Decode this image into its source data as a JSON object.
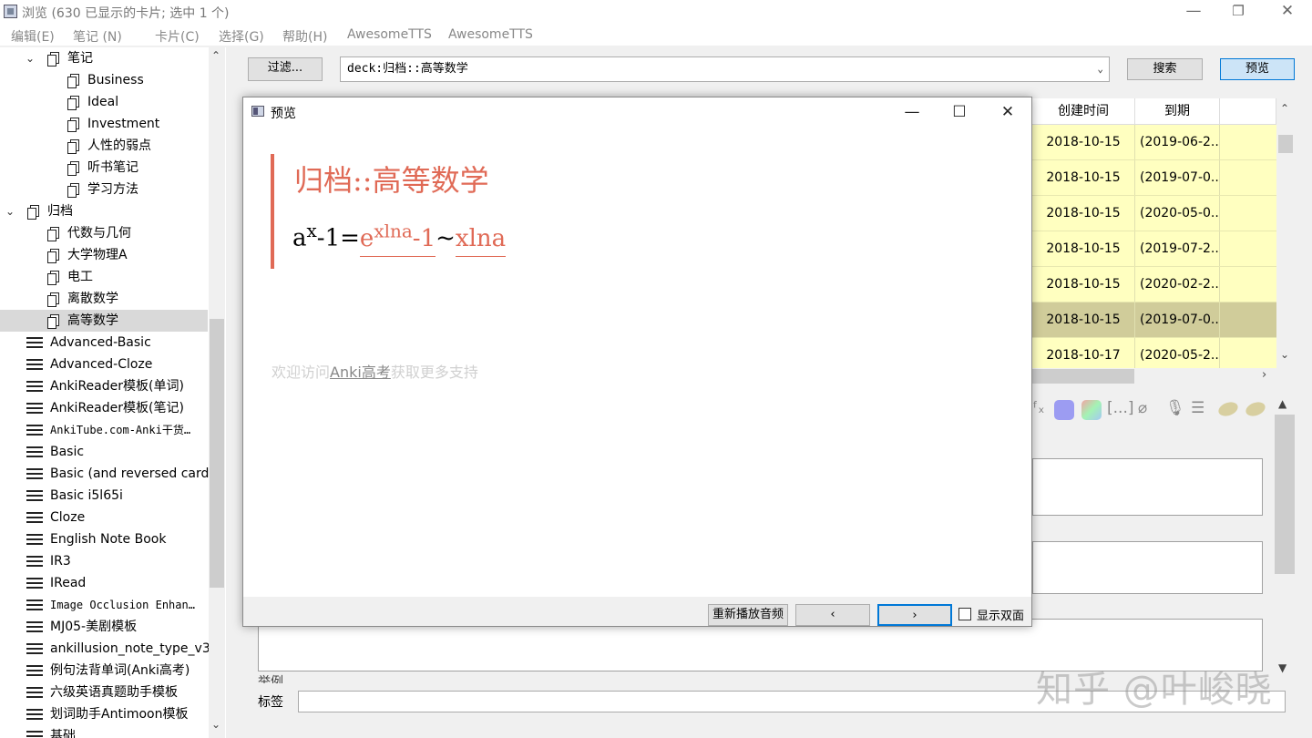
{
  "window": {
    "title": "浏览 (630 已显示的卡片; 选中 1 个)"
  },
  "window_controls": {
    "minimize": "—",
    "restore": "❐",
    "close": "✕"
  },
  "menu": [
    "编辑(E)",
    "笔记 (N)",
    "卡片(C)",
    "选择(G)",
    "帮助(H)",
    "AwesomeTTS",
    "AwesomeTTS"
  ],
  "sidebar": {
    "items": [
      {
        "label": "笔记",
        "level": 1,
        "kind": "deck",
        "arrow": "⌄"
      },
      {
        "label": "Business",
        "level": 2,
        "kind": "deck"
      },
      {
        "label": "Ideal",
        "level": 2,
        "kind": "deck"
      },
      {
        "label": "Investment",
        "level": 2,
        "kind": "deck"
      },
      {
        "label": "人性的弱点",
        "level": 2,
        "kind": "deck"
      },
      {
        "label": "听书笔记",
        "level": 2,
        "kind": "deck"
      },
      {
        "label": "学习方法",
        "level": 2,
        "kind": "deck"
      },
      {
        "label": "归档",
        "level": 0,
        "kind": "deck",
        "arrow": "⌄"
      },
      {
        "label": "代数与几何",
        "level": 1,
        "kind": "deck"
      },
      {
        "label": "大学物理A",
        "level": 1,
        "kind": "deck"
      },
      {
        "label": "电工",
        "level": 1,
        "kind": "deck"
      },
      {
        "label": "离散数学",
        "level": 1,
        "kind": "deck"
      },
      {
        "label": "高等数学",
        "level": 1,
        "kind": "deck",
        "selected": true
      },
      {
        "label": "Advanced-Basic",
        "level": 0,
        "kind": "note"
      },
      {
        "label": "Advanced-Cloze",
        "level": 0,
        "kind": "note"
      },
      {
        "label": "AnkiReader模板(单词)",
        "level": 0,
        "kind": "note"
      },
      {
        "label": "AnkiReader模板(笔记)",
        "level": 0,
        "kind": "note"
      },
      {
        "label": "AnkiTube.com-Anki干货…",
        "level": 0,
        "kind": "note",
        "mono": true
      },
      {
        "label": "Basic",
        "level": 0,
        "kind": "note"
      },
      {
        "label": "Basic (and reversed card)",
        "level": 0,
        "kind": "note"
      },
      {
        "label": "Basic i5l65i",
        "level": 0,
        "kind": "note"
      },
      {
        "label": "Cloze",
        "level": 0,
        "kind": "note"
      },
      {
        "label": "English Note Book",
        "level": 0,
        "kind": "note"
      },
      {
        "label": "IR3",
        "level": 0,
        "kind": "note"
      },
      {
        "label": "IRead",
        "level": 0,
        "kind": "note"
      },
      {
        "label": "Image Occlusion Enhan…",
        "level": 0,
        "kind": "note",
        "mono": true
      },
      {
        "label": "MJ05-美剧模板",
        "level": 0,
        "kind": "note"
      },
      {
        "label": "ankillusion_note_type_v3",
        "level": 0,
        "kind": "note"
      },
      {
        "label": "例句法背单词(Anki高考)",
        "level": 0,
        "kind": "note"
      },
      {
        "label": "六级英语真题助手模板",
        "level": 0,
        "kind": "note"
      },
      {
        "label": "划词助手Antimoon模板",
        "level": 0,
        "kind": "note"
      },
      {
        "label": "基础",
        "level": 0,
        "kind": "note"
      }
    ]
  },
  "toolbar": {
    "filter_label": "过滤...",
    "search_query": "deck:归档::高等数学",
    "search_label": "搜索",
    "preview_label": "预览"
  },
  "table": {
    "columns": [
      "创建时间",
      "到期"
    ],
    "rows": [
      {
        "created": "2018-10-15",
        "due": "(2019-06-2..."
      },
      {
        "created": "2018-10-15",
        "due": "(2019-07-0..."
      },
      {
        "created": "2018-10-15",
        "due": "(2020-05-0..."
      },
      {
        "created": "2018-10-15",
        "due": "(2019-07-2..."
      },
      {
        "created": "2018-10-15",
        "due": "(2020-02-2..."
      },
      {
        "created": "2018-10-15",
        "due": "(2019-07-0...",
        "selected": true
      },
      {
        "created": "2018-10-17",
        "due": "(2020-05-2..."
      }
    ],
    "row_color": "#ffffc0",
    "selected_row_color": "#d0cc9a"
  },
  "editor": {
    "partial_label": "举例",
    "tags_label": "标签",
    "tags_value": ""
  },
  "preview_dialog": {
    "title": "预览",
    "deck_name": "归档::高等数学",
    "formula": {
      "base": "a",
      "exp": "x",
      "minus1": "-1=",
      "e": "e",
      "e_exp": "xlna",
      "tail": "-1",
      "tilde": "~",
      "rhs": "xlna"
    },
    "footer_prefix": "欢迎访问",
    "footer_link": "Anki高考",
    "footer_suffix": "获取更多支持",
    "replay_label": "重新播放音频",
    "prev_label": "‹",
    "next_label": "›",
    "show_both_label": "显示双面",
    "show_both_checked": false,
    "accent_color": "#e06a56"
  },
  "watermark": "知乎 @叶峻晓"
}
